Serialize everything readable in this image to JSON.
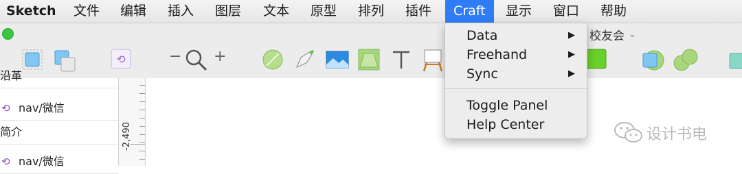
{
  "menubar": {
    "app": "Sketch",
    "items": [
      "文件",
      "编辑",
      "插入",
      "图层",
      "文本",
      "原型",
      "排列",
      "插件",
      "Craft",
      "显示",
      "窗口",
      "帮助"
    ]
  },
  "window": {
    "title": "校友会"
  },
  "toolbar": {
    "zoom_minus": "−",
    "zoom_plus": "+"
  },
  "sidebar": {
    "rows": [
      {
        "label": "沿革",
        "symbol": false
      },
      {
        "label": "nav/微信",
        "symbol": true
      },
      {
        "label": "简介",
        "symbol": false
      },
      {
        "label": "nav/微信",
        "symbol": true
      }
    ]
  },
  "ruler": {
    "label": "-2,490"
  },
  "craft_menu": {
    "items": [
      {
        "label": "Data",
        "submenu": true
      },
      {
        "label": "Freehand",
        "submenu": true
      },
      {
        "label": "Sync",
        "submenu": true
      },
      {
        "label": "Toggle Panel",
        "submenu": false
      },
      {
        "label": "Help Center",
        "submenu": false
      }
    ]
  },
  "watermark": {
    "text": "设计书电"
  },
  "icons": {
    "submenu_arrow": "▶",
    "symbol_glyph": "⟲",
    "chevron": "⌄"
  },
  "colors": {
    "menu_highlight": "#2f7cf6",
    "traffic_green": "#3bc640",
    "symbol_purple": "#8a4fc4"
  }
}
